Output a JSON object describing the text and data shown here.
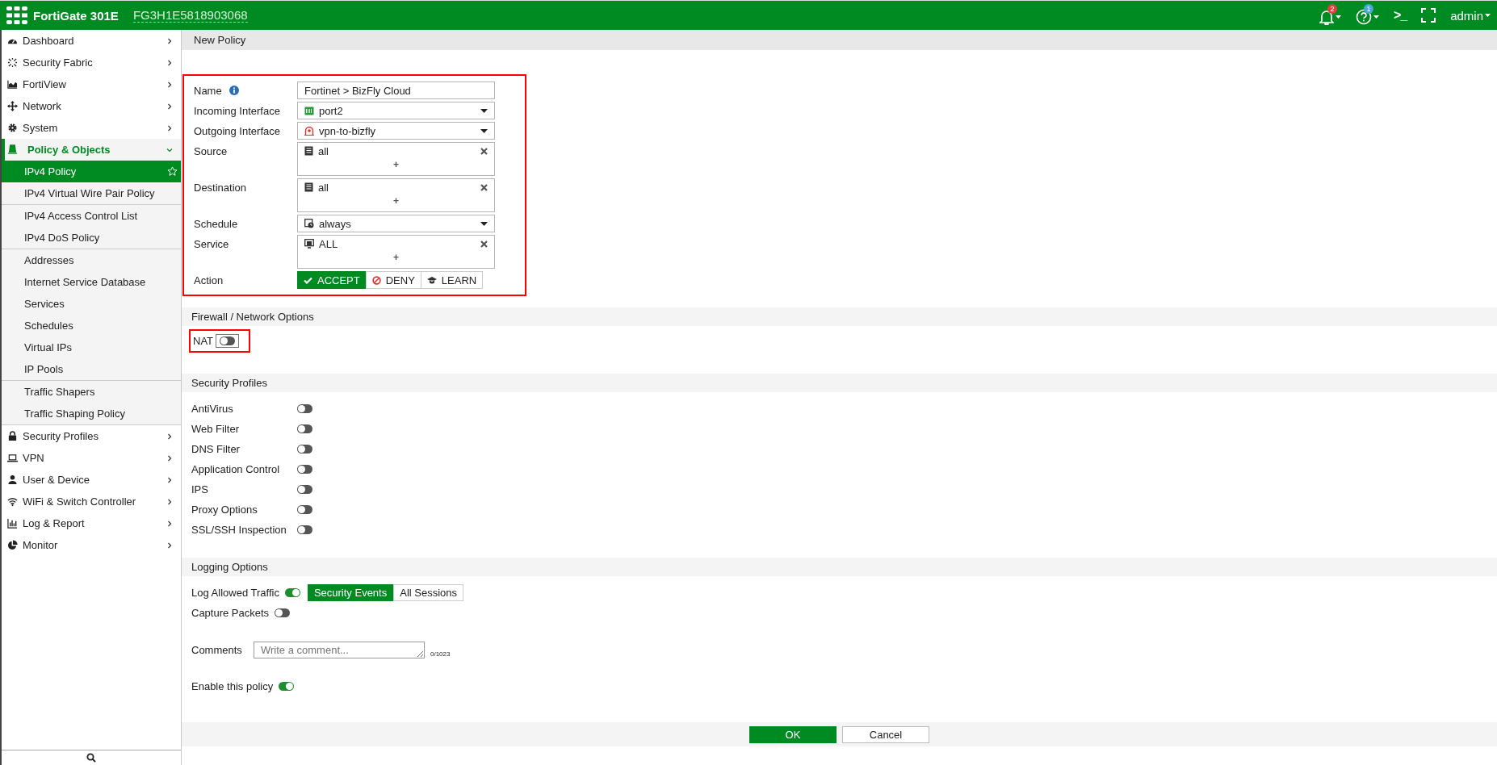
{
  "topbar": {
    "product": "FortiGate 301E",
    "serial": "FG3H1E5818903068",
    "alerts_badge": "2",
    "help_badge": "1",
    "terminal": ">_",
    "user": "admin"
  },
  "sidebar": {
    "items": [
      {
        "label": "Dashboard",
        "expanded": false,
        "selected": false
      },
      {
        "label": "Security Fabric",
        "expanded": false,
        "selected": false
      },
      {
        "label": "FortiView",
        "expanded": false,
        "selected": false
      },
      {
        "label": "Network",
        "expanded": false,
        "selected": false
      },
      {
        "label": "System",
        "expanded": false,
        "selected": false
      },
      {
        "label": "Policy & Objects",
        "expanded": true,
        "selected": true,
        "children": [
          {
            "items": [
              {
                "label": "IPv4 Policy",
                "selected": true
              },
              {
                "label": "IPv4 Virtual Wire Pair Policy",
                "selected": false
              }
            ]
          },
          {
            "items": [
              {
                "label": "IPv4 Access Control List",
                "selected": false
              },
              {
                "label": "IPv4 DoS Policy",
                "selected": false
              }
            ]
          },
          {
            "items": [
              {
                "label": "Addresses",
                "selected": false
              },
              {
                "label": "Internet Service Database",
                "selected": false
              },
              {
                "label": "Services",
                "selected": false
              },
              {
                "label": "Schedules",
                "selected": false
              },
              {
                "label": "Virtual IPs",
                "selected": false
              },
              {
                "label": "IP Pools",
                "selected": false
              }
            ]
          },
          {
            "items": [
              {
                "label": "Traffic Shapers",
                "selected": false
              },
              {
                "label": "Traffic Shaping Policy",
                "selected": false
              }
            ]
          }
        ]
      },
      {
        "label": "Security Profiles",
        "expanded": false,
        "selected": false
      },
      {
        "label": "VPN",
        "expanded": false,
        "selected": false
      },
      {
        "label": "User & Device",
        "expanded": false,
        "selected": false
      },
      {
        "label": "WiFi & Switch Controller",
        "expanded": false,
        "selected": false
      },
      {
        "label": "Log & Report",
        "expanded": false,
        "selected": false
      },
      {
        "label": "Monitor",
        "expanded": false,
        "selected": false
      }
    ]
  },
  "page_title": "New Policy",
  "policy_form": {
    "fields": [
      {
        "kind": "text",
        "label": "Name",
        "value": "Fortinet > BizFly Cloud"
      },
      {
        "kind": "select",
        "label": "Incoming Interface",
        "value": "port2"
      },
      {
        "kind": "select",
        "label": "Outgoing Interface",
        "value": "vpn-to-bizfly"
      },
      {
        "kind": "multi",
        "label": "Source",
        "value": "all",
        "add": "+"
      },
      {
        "kind": "multi",
        "label": "Destination",
        "value": "all",
        "add": "+"
      },
      {
        "kind": "select",
        "label": "Schedule",
        "value": "always"
      },
      {
        "kind": "multi",
        "label": "Service",
        "value": "ALL",
        "add": "+"
      },
      {
        "kind": "buttons",
        "label": "Action",
        "options": [
          {
            "label": "ACCEPT",
            "selected": true
          },
          {
            "label": "DENY",
            "selected": false
          },
          {
            "label": "LEARN",
            "selected": false
          }
        ]
      }
    ]
  },
  "firewall_options": {
    "title": "Firewall / Network Options",
    "toggles": [
      {
        "label": "NAT",
        "on": false
      }
    ]
  },
  "security_profiles": {
    "title": "Security Profiles",
    "toggles": [
      {
        "label": "AntiVirus",
        "on": false
      },
      {
        "label": "Web Filter",
        "on": false
      },
      {
        "label": "DNS Filter",
        "on": false
      },
      {
        "label": "Application Control",
        "on": false
      },
      {
        "label": "IPS",
        "on": false
      },
      {
        "label": "Proxy Options",
        "on": false
      },
      {
        "label": "SSL/SSH Inspection",
        "on": false
      }
    ]
  },
  "logging_options": {
    "title": "Logging Options",
    "log_allowed_traffic": {
      "label": "Log Allowed Traffic",
      "on": true,
      "options": [
        {
          "label": "Security Events",
          "selected": true
        },
        {
          "label": "All Sessions",
          "selected": false
        }
      ]
    },
    "capture_packets": {
      "label": "Capture Packets",
      "on": false
    },
    "comments": {
      "label": "Comments",
      "placeholder": "Write a comment...",
      "counter": "0/1023"
    },
    "enable_policy": {
      "label": "Enable this policy",
      "on": true
    }
  },
  "footer_buttons": [
    {
      "label": "OK",
      "kind": "primary"
    },
    {
      "label": "Cancel",
      "kind": "secondary"
    }
  ]
}
